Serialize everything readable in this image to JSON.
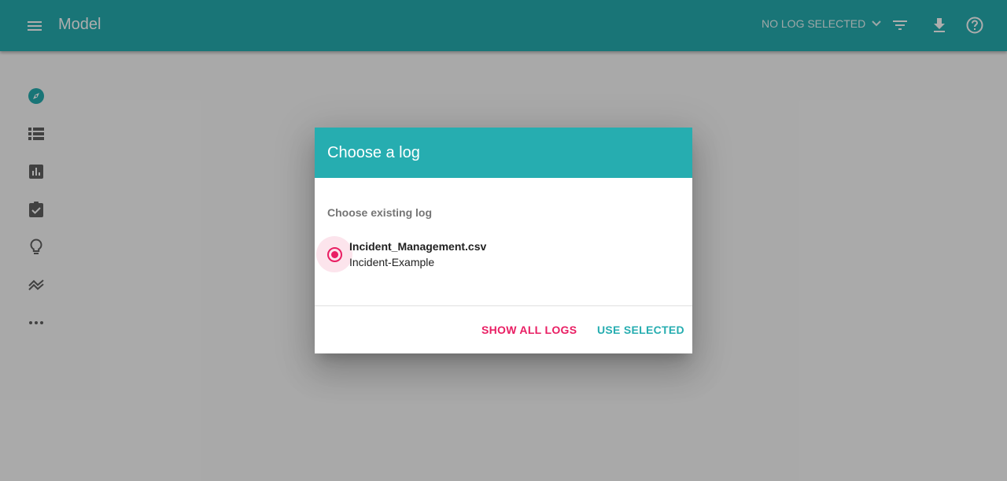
{
  "appbar": {
    "title": "Model",
    "log_selector": "NO LOG SELECTED",
    "icons": [
      "menu-icon",
      "filter-icon",
      "download-icon",
      "help-icon"
    ]
  },
  "sidebar": {
    "items": [
      {
        "icon": "compass-icon",
        "active": true
      },
      {
        "icon": "list-icon",
        "active": false
      },
      {
        "icon": "bar-chart-icon",
        "active": false
      },
      {
        "icon": "assignment-check-icon",
        "active": false
      },
      {
        "icon": "lightbulb-icon",
        "active": false
      },
      {
        "icon": "trend-icon",
        "active": false
      },
      {
        "icon": "more-horiz-icon",
        "active": false
      }
    ]
  },
  "dialog": {
    "title": "Choose a log",
    "section_label": "Choose existing log",
    "option": {
      "name": "Incident_Management.csv",
      "description": "Incident-Example",
      "selected": true
    },
    "buttons": {
      "show_all": "SHOW ALL LOGS",
      "use_selected": "USE SELECTED"
    }
  },
  "colors": {
    "primary": "#26adb0",
    "accent": "#e91e63",
    "scrim": "rgba(0,0,0,0.32)"
  }
}
